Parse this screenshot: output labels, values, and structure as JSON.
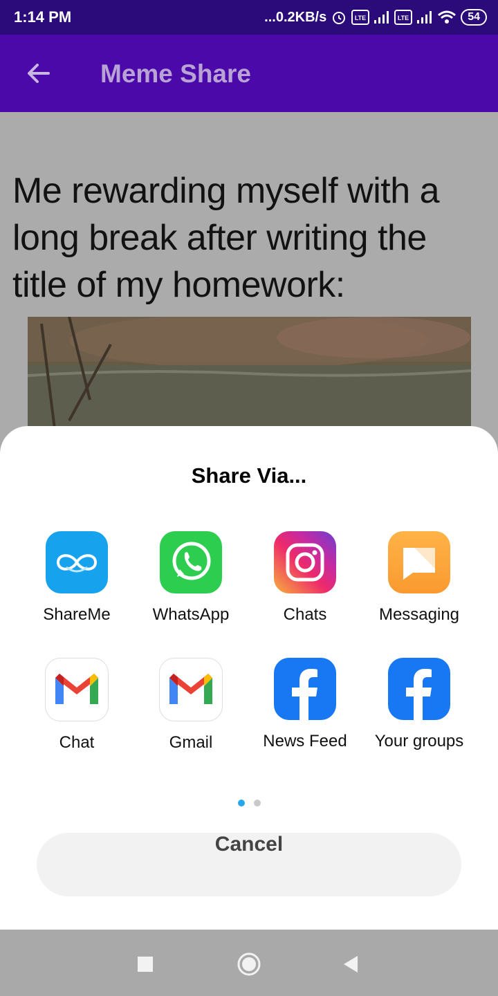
{
  "status_bar": {
    "time": "1:14 PM",
    "network_speed": "...0.2KB/s",
    "battery": "54",
    "icons": [
      "alarm-icon",
      "volte-icon",
      "signal-icon",
      "volte-icon",
      "signal-icon",
      "wifi-icon",
      "battery-icon"
    ]
  },
  "app_bar": {
    "title": "Meme Share",
    "back_icon": "arrow-back-icon"
  },
  "meme": {
    "caption": "Me rewarding myself with a long break after writing the title of my homework:"
  },
  "share_sheet": {
    "title": "Share Via...",
    "apps": [
      {
        "label": "ShareMe",
        "icon": "shareme-icon"
      },
      {
        "label": "WhatsApp",
        "icon": "whatsapp-icon"
      },
      {
        "label": "Chats",
        "icon": "instagram-icon"
      },
      {
        "label": "Messaging",
        "icon": "messaging-icon"
      },
      {
        "label": "Chat",
        "icon": "gmail-icon"
      },
      {
        "label": "Gmail",
        "icon": "gmail-icon"
      },
      {
        "label": "News Feed",
        "icon": "facebook-icon"
      },
      {
        "label": "Your groups",
        "icon": "facebook-icon"
      }
    ],
    "page_count": 2,
    "current_page": 1,
    "cancel_label": "Cancel"
  },
  "nav_bar": {
    "icons": [
      "recents-icon",
      "home-icon",
      "back-icon"
    ]
  },
  "colors": {
    "status_bar": "#2b0a7a",
    "app_bar": "#4a09a8",
    "dot_active": "#29a6ee",
    "dot_inactive": "#c9c9c9"
  }
}
